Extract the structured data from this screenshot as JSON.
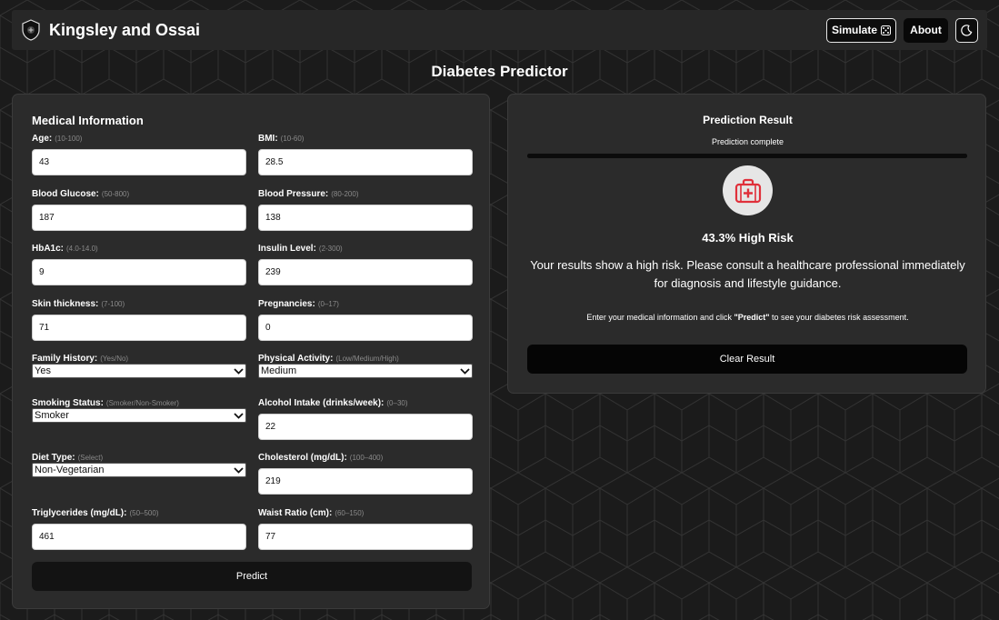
{
  "nav": {
    "brand": "Kingsley and Ossai",
    "simulate_label": "Simulate",
    "about_label": "About"
  },
  "page": {
    "title": "Diabetes Predictor"
  },
  "form": {
    "title": "Medical Information",
    "fields": [
      {
        "label": "Age:",
        "hint": "(10-100)",
        "value": "43",
        "kind": "input"
      },
      {
        "label": "BMI:",
        "hint": "(10-60)",
        "value": "28.5",
        "kind": "input"
      },
      {
        "label": "Blood Glucose:",
        "hint": "(50-800)",
        "value": "187",
        "kind": "input"
      },
      {
        "label": "Blood Pressure:",
        "hint": "(80-200)",
        "value": "138",
        "kind": "input"
      },
      {
        "label": "HbA1c:",
        "hint": "(4.0-14.0)",
        "value": "9",
        "kind": "input"
      },
      {
        "label": "Insulin Level:",
        "hint": "(2-300)",
        "value": "239",
        "kind": "input"
      },
      {
        "label": "Skin thickness:",
        "hint": "(7-100)",
        "value": "71",
        "kind": "input"
      },
      {
        "label": "Pregnancies:",
        "hint": "(0–17)",
        "value": "0",
        "kind": "input"
      },
      {
        "label": "Family History:",
        "hint": "(Yes/No)",
        "value": "Yes",
        "kind": "select"
      },
      {
        "label": "Physical Activity:",
        "hint": "(Low/Medium/High)",
        "value": "Medium",
        "kind": "select"
      },
      {
        "label": "Smoking Status:",
        "hint": "(Smoker/Non-Smoker)",
        "value": "Smoker",
        "kind": "select"
      },
      {
        "label": "Alcohol Intake (drinks/week):",
        "hint": "(0–30)",
        "value": "22",
        "kind": "input"
      },
      {
        "label": "Diet Type:",
        "hint": "(Select)",
        "value": "Non-Vegetarian",
        "kind": "select"
      },
      {
        "label": "Cholesterol (mg/dL):",
        "hint": "(100–400)",
        "value": "219",
        "kind": "input"
      },
      {
        "label": "Triglycerides (mg/dL):",
        "hint": "(50–500)",
        "value": "461",
        "kind": "input"
      },
      {
        "label": "Waist Ratio (cm):",
        "hint": "(60–150)",
        "value": "77",
        "kind": "input"
      }
    ],
    "predict_label": "Predict"
  },
  "result": {
    "title": "Prediction Result",
    "status": "Prediction complete",
    "progress": 1.0,
    "risk_label": "43.3% High Risk",
    "message": "Your results show a high risk. Please consult a healthcare professional immediately for diagnosis and lifestyle guidance.",
    "instruction_pre": "Enter your medical information and click ",
    "instruction_bold": "\"Predict\"",
    "instruction_post": " to see your diabetes risk assessment.",
    "clear_label": "Clear Result",
    "icon": "medical-kit-icon",
    "icon_color": "#e0303b"
  },
  "theme": {
    "icon": "moon-icon",
    "background": "#1b1b1b",
    "card": "#2b2b2b"
  }
}
